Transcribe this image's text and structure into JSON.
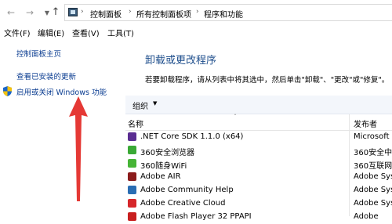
{
  "nav": {
    "back_icon": "arrow-left-icon",
    "forward_icon": "arrow-right-icon",
    "recent_icon": "chevron-down-icon",
    "up_icon": "arrow-up-icon"
  },
  "breadcrumb": [
    "控制面板",
    "所有控制面板项",
    "程序和功能"
  ],
  "menu": [
    "文件(F)",
    "编辑(E)",
    "查看(V)",
    "工具(T)"
  ],
  "sidebar": {
    "home": "控制面板主页",
    "updates": "查看已安装的更新",
    "features": "启用或关闭 Windows 功能"
  },
  "main": {
    "title": "卸载或更改程序",
    "description": "若要卸载程序，请从列表中将其选中，然后单击\"卸载\"、\"更改\"或\"修复\"。"
  },
  "toolbar": {
    "organize": "组织"
  },
  "columns": {
    "name": "名称",
    "publisher": "发布者"
  },
  "programs": [
    {
      "name": ".NET Core SDK 1.1.0 (x64)",
      "publisher": "Microsoft",
      "icon": "dotnet-icon",
      "color": "#5a2d91"
    },
    {
      "name": "360安全浏览器",
      "publisher": "360安全中",
      "icon": "360-browser-icon",
      "color": "#3aa935"
    },
    {
      "name": "360随身WiFi",
      "publisher": "360互联网",
      "icon": "360-wifi-icon",
      "color": "#46b436"
    },
    {
      "name": "Adobe AIR",
      "publisher": "Adobe Sys",
      "icon": "adobe-air-icon",
      "color": "#8b1b1b"
    },
    {
      "name": "Adobe Community Help",
      "publisher": "Adobe Sys",
      "icon": "adobe-help-icon",
      "color": "#2a6db3"
    },
    {
      "name": "Adobe Creative Cloud",
      "publisher": "Adobe Sys",
      "icon": "creative-cloud-icon",
      "color": "#d6262a"
    },
    {
      "name": "Adobe Flash Player 32 PPAPI",
      "publisher": "Adobe",
      "icon": "flash-icon",
      "color": "#c81f1f"
    }
  ],
  "colors": {
    "link": "#0b3d91",
    "title": "#1e4e8c",
    "arrow": "#e53935"
  }
}
